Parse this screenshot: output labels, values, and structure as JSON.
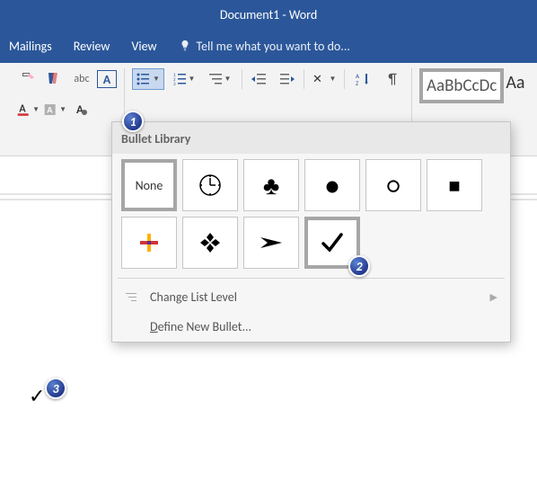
{
  "title": "Document1 - Word",
  "tabs": {
    "mailings": "Mailings",
    "review": "Review",
    "view": "View",
    "tellme": "Tell me what you want to do..."
  },
  "styles": {
    "normal": "AaBbCcDc",
    "extra": "Aa"
  },
  "dropdown": {
    "header": "Bullet Library",
    "tiles": {
      "none": "None"
    },
    "changeLevel": "Change List Level",
    "defineNew": "Define New Bullet..."
  },
  "badges": {
    "b1": "1",
    "b2": "2",
    "b3": "3"
  }
}
